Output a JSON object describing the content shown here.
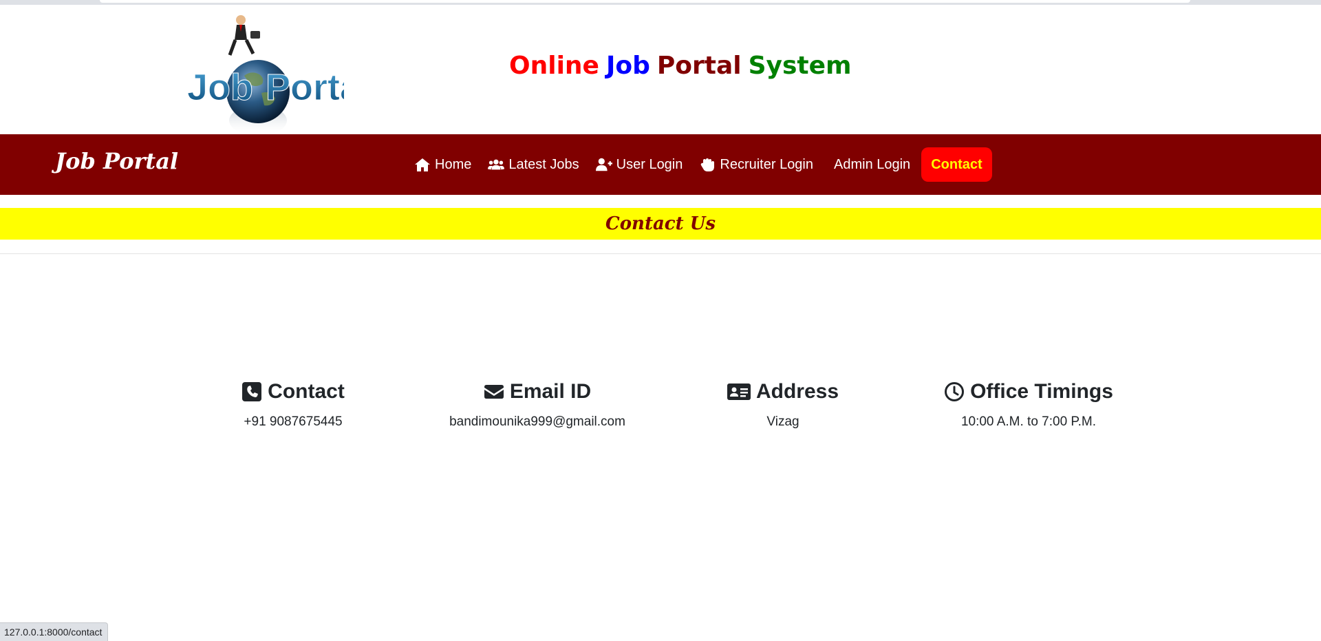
{
  "header": {
    "logo_text": [
      "Job",
      "Portal"
    ],
    "title_words": [
      {
        "text": "Online",
        "color": "#ff0000"
      },
      {
        "text": "Job",
        "color": "#0000ff"
      },
      {
        "text": "Portal",
        "color": "#800000"
      },
      {
        "text": "System",
        "color": "#008000"
      }
    ]
  },
  "navbar": {
    "brand": "Job Portal",
    "items": [
      {
        "label": "Home",
        "icon": "home-icon"
      },
      {
        "label": "Latest Jobs",
        "icon": "users-icon"
      },
      {
        "label": "User Login",
        "icon": "user-plus-icon"
      },
      {
        "label": "Recruiter Login",
        "icon": "hand-icon"
      },
      {
        "label": "Admin Login",
        "icon": ""
      },
      {
        "label": "Contact",
        "icon": "",
        "active": true
      }
    ],
    "colors": {
      "background": "#800000",
      "active_bg": "#ff0000",
      "active_text": "#ffff00"
    }
  },
  "page": {
    "heading": "Contact Us",
    "heading_bg": "#ffff00",
    "heading_color": "#800000"
  },
  "info": [
    {
      "title": "Contact",
      "icon": "phone-icon",
      "value": "+91 9087675445"
    },
    {
      "title": "Email ID",
      "icon": "envelope-icon",
      "value": "bandimounika999@gmail.com"
    },
    {
      "title": "Address",
      "icon": "id-card-icon",
      "value": "Vizag"
    },
    {
      "title": "Office Timings",
      "icon": "clock-icon",
      "value": "10:00 A.M. to 7:00 P.M."
    }
  ],
  "status_bar": {
    "url": "127.0.0.1:8000/contact"
  }
}
